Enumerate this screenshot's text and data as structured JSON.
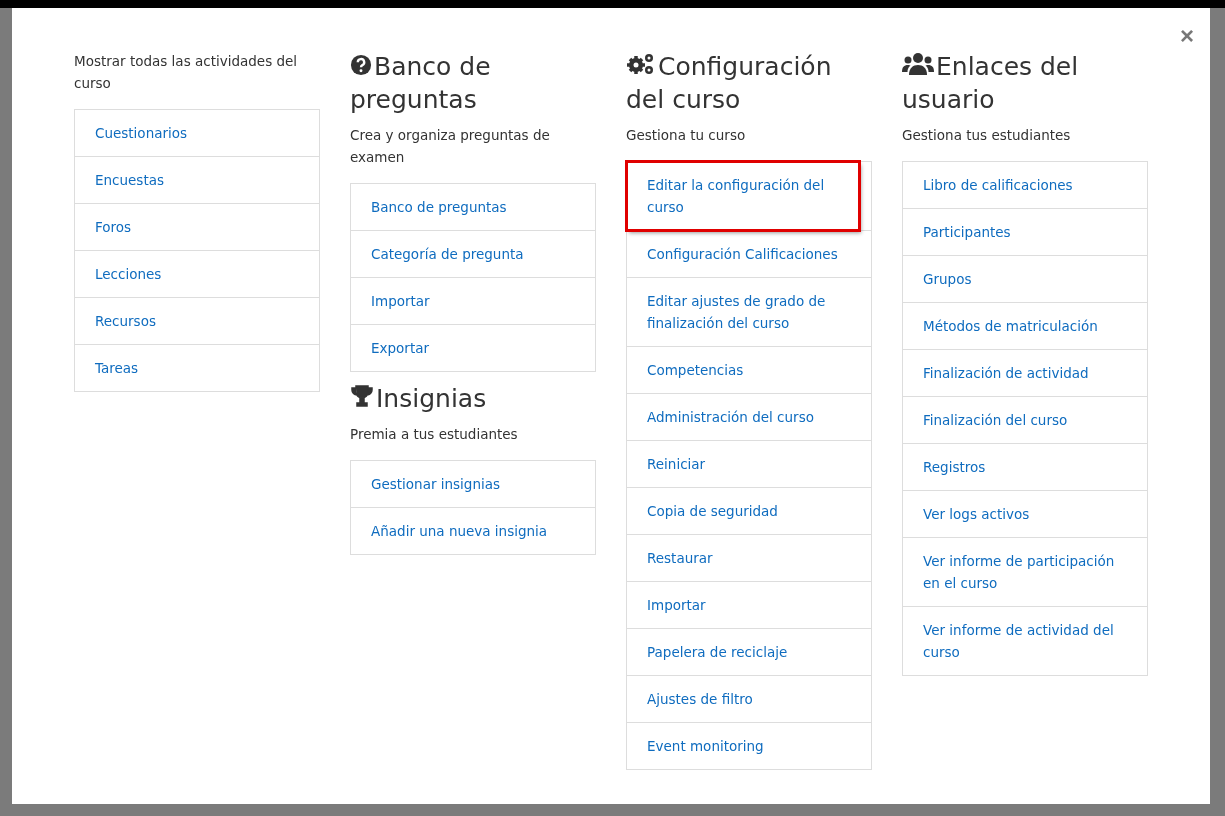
{
  "modal": {
    "close": "×",
    "columns": [
      {
        "sections": [
          {
            "description": "Mostrar todas las actividades del curso",
            "links": [
              {
                "label": "Cuestionarios",
                "highlighted": false
              },
              {
                "label": "Encuestas",
                "highlighted": false
              },
              {
                "label": "Foros",
                "highlighted": false
              },
              {
                "label": "Lecciones",
                "highlighted": false
              },
              {
                "label": "Recursos",
                "highlighted": false
              },
              {
                "label": "Tareas",
                "highlighted": false
              }
            ]
          }
        ]
      },
      {
        "sections": [
          {
            "title": "Banco de preguntas",
            "description": "Crea y organiza preguntas de examen",
            "links": [
              {
                "label": "Banco de preguntas",
                "highlighted": false
              },
              {
                "label": "Categoría de pregunta",
                "highlighted": false
              },
              {
                "label": "Importar",
                "highlighted": false
              },
              {
                "label": "Exportar",
                "highlighted": false
              }
            ]
          },
          {
            "title": "Insignias",
            "description": "Premia a tus estudiantes",
            "links": [
              {
                "label": "Gestionar insignias",
                "highlighted": false
              },
              {
                "label": "Añadir una nueva insignia",
                "highlighted": false
              }
            ]
          }
        ]
      },
      {
        "sections": [
          {
            "title": "Configuración del curso",
            "description": "Gestiona tu curso",
            "links": [
              {
                "label": "Editar la configuración del curso",
                "highlighted": true
              },
              {
                "label": "Configuración Calificaciones",
                "highlighted": false
              },
              {
                "label": "Editar ajustes de grado de finalización del curso",
                "highlighted": false
              },
              {
                "label": "Competencias",
                "highlighted": false
              },
              {
                "label": "Administración del curso",
                "highlighted": false
              },
              {
                "label": "Reiniciar",
                "highlighted": false
              },
              {
                "label": "Copia de seguridad",
                "highlighted": false
              },
              {
                "label": "Restaurar",
                "highlighted": false
              },
              {
                "label": "Importar",
                "highlighted": false
              },
              {
                "label": "Papelera de reciclaje",
                "highlighted": false
              },
              {
                "label": "Ajustes de filtro",
                "highlighted": false
              },
              {
                "label": "Event monitoring",
                "highlighted": false
              }
            ]
          }
        ]
      },
      {
        "sections": [
          {
            "title": "Enlaces del usuario",
            "description": "Gestiona tus estudiantes",
            "links": [
              {
                "label": "Libro de calificaciones",
                "highlighted": false
              },
              {
                "label": "Participantes",
                "highlighted": false
              },
              {
                "label": "Grupos",
                "highlighted": false
              },
              {
                "label": "Métodos de matriculación",
                "highlighted": false
              },
              {
                "label": "Finalización de actividad",
                "highlighted": false
              },
              {
                "label": "Finalización del curso",
                "highlighted": false
              },
              {
                "label": "Registros",
                "highlighted": false
              },
              {
                "label": "Ver logs activos",
                "highlighted": false
              },
              {
                "label": "Ver informe de participación en el curso",
                "highlighted": false
              },
              {
                "label": "Ver informe de actividad del curso",
                "highlighted": false
              }
            ]
          }
        ]
      }
    ]
  }
}
